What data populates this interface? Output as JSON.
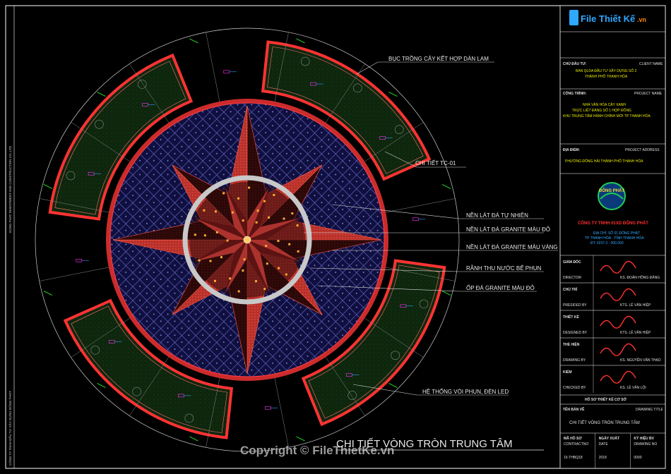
{
  "colors": {
    "background": "#000000",
    "frame": "#ffffff",
    "planter_fill": "#0f2a0f",
    "planter_edge": "#ff3333",
    "star_red": "#c23a34",
    "star_dark": "#5a1212",
    "paving": "#1a1a55",
    "dimension_green": "#22dd22",
    "marker_magenta": "#ff33ff",
    "led_orange": "#ffaa33"
  },
  "callouts": [
    {
      "id": "planter",
      "text": "BỤC TRỒNG CÂY KẾT HỢP DÀN LAM"
    },
    {
      "id": "detail",
      "text": "CHI TIẾT TC-01"
    },
    {
      "id": "natural-stone",
      "text": "NỀN LÁT ĐÁ TỰ NHIÊN"
    },
    {
      "id": "red-granite",
      "text": "NỀN LÁT ĐÁ GRANITE MÀU ĐỎ"
    },
    {
      "id": "yellow-granite",
      "text": "NỀN LÁT ĐÁ GRANITE MÀU VÀNG"
    },
    {
      "id": "drain",
      "text": "RÃNH THU NƯỚC BỂ PHUN"
    },
    {
      "id": "cladding",
      "text": "ỐP ĐÁ GRANITE MÀU ĐỎ"
    },
    {
      "id": "fountain",
      "text": "HỆ THỐNG VÒI PHUN, ĐÈN LED"
    }
  ],
  "drawing_title": "CHI TIẾT VÒNG TRÒN TRUNG TÂM",
  "watermark": "Copyright © FileThietKe.vn",
  "logo_text": {
    "main": "File Thiết Kế",
    "suffix": ".vn"
  },
  "title_block": {
    "owner_label": "CHỦ ĐẦU TƯ:",
    "owner_label_en": "CLIENT NAME",
    "owner_line1": "BAN QLDA ĐẦU TƯ XÂY DỰNG SỐ 2",
    "owner_line2": "THÀNH PHỐ THANH HÓA",
    "project_label": "CÔNG TRÌNH:",
    "project_label_en": "PROJECT NAME",
    "project_line1": "NHÀ VĂN HÓA CÂY XANH",
    "project_line2": "TRỰC LIỆT ĐÀNG SỐ 1 HỢP ĐỒNG",
    "project_line3": "KHU TRUNG TÂM HÀNH CHÍNH MỚI TP THANH HÓA",
    "location_label": "ĐỊA ĐIỂM:",
    "location_label_en": "PROJECT ADDRESS",
    "location_value": "PHƯỜNG ĐÔNG HẢI THÀNH PHỐ THANH HÓA",
    "company_logo": "ĐÔNG PHÁT",
    "company_name": "CÔNG TY TNHH 01XD ĐÔNG PHÁT",
    "company_addr1": "ĐỊA CHỈ: SỐ 01 ĐÔNG PHÁT",
    "company_addr2": "TP THANH HÓA · TỈNH THANH HÓA",
    "company_addr3": "ĐT: 0237.3 - 000.000",
    "sign_rows": [
      {
        "role": "GIÁM ĐỐC",
        "role_en": "DIRECTOR",
        "name": "KS. ĐOÀN HỒNG ĐĂNG"
      },
      {
        "role": "CHỦ TRÌ",
        "role_en": "PRESIDED BY",
        "name": "KTS. LÊ VĂN HIỆP"
      },
      {
        "role": "THIẾT KẾ",
        "role_en": "DESIGNED BY",
        "name": "KTS. LÊ VĂN HIỆP"
      },
      {
        "role": "THỂ HIỆN",
        "role_en": "DRAWING BY",
        "name": "KS. NGUYỄN VĂN THẠO"
      },
      {
        "role": "KIỂM",
        "role_en": "CHECKED BY",
        "name": "KS. LÊ VĂN LỘI"
      }
    ],
    "phase": "HỒ SƠ THIẾT KẾ CƠ SỞ",
    "sheet_label": "TÊN BẢN VẼ",
    "sheet_label_en": "DRAWING TITLE",
    "sheet_title": "CHI TIẾT VÒNG TRÒN TRUNG TÂM",
    "footer_cols": [
      {
        "label": "MÃ HỒ SƠ",
        "label_en": "CONTRACTNO",
        "value": "15-THBQ18"
      },
      {
        "label": "NGÀY XUẤT",
        "label_en": "DATE",
        "value": "2018"
      },
      {
        "label": "KÝ HIỆU BV",
        "label_en": "DRAWING NO",
        "value": "0000"
      }
    ]
  },
  "side_text": "CÔNG TY TNHH ĐẦU TƯ XÂY DỰNG ĐÔNG PHÁT",
  "side_text_2": "DONG PHAT INVESTMENT AND CONSTRUCTION CO.,LTD"
}
